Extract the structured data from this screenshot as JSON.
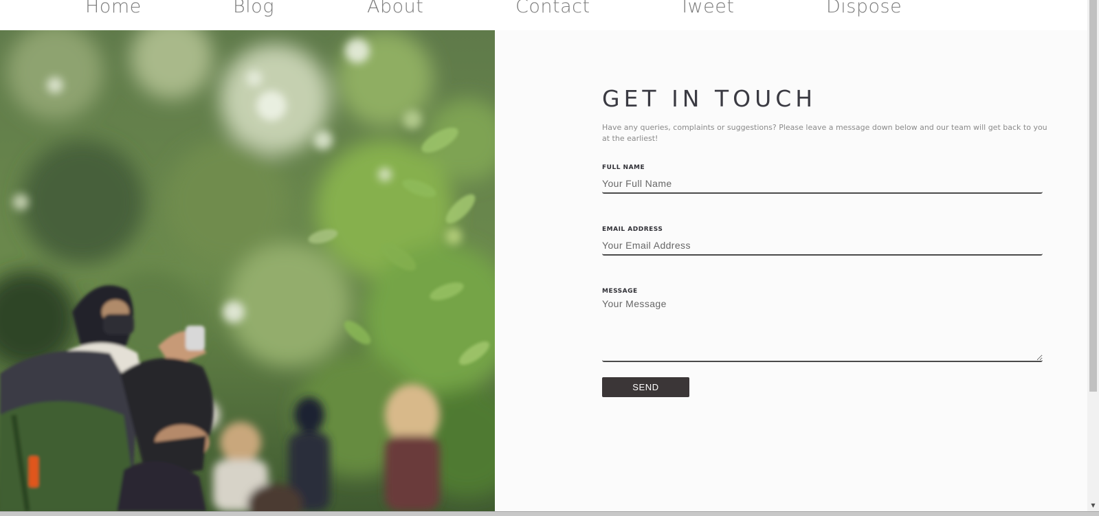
{
  "nav": {
    "items": [
      {
        "label": "Home"
      },
      {
        "label": "Blog"
      },
      {
        "label": "About"
      },
      {
        "label": "Contact"
      },
      {
        "label": "Tweet"
      },
      {
        "label": "Dispose"
      }
    ]
  },
  "contact": {
    "title": "GET IN TOUCH",
    "description": "Have any queries, complaints or suggestions? Please leave a message down below and our team will get back to you at the earliest!",
    "full_name": {
      "label": "FULL NAME",
      "placeholder": "Your Full Name",
      "value": ""
    },
    "email": {
      "label": "EMAIL ADDRESS",
      "placeholder": "Your Email Address",
      "value": ""
    },
    "message": {
      "label": "MESSAGE",
      "placeholder": "Your Message",
      "value": ""
    },
    "send_label": "SEND"
  },
  "colors": {
    "nav_text": "#7a7a7a",
    "title": "#3a3a42",
    "button_bg": "#3b3637",
    "panel_bg": "#fbfbfb"
  },
  "icons": {
    "scroll_down": "chevron-down-icon"
  }
}
